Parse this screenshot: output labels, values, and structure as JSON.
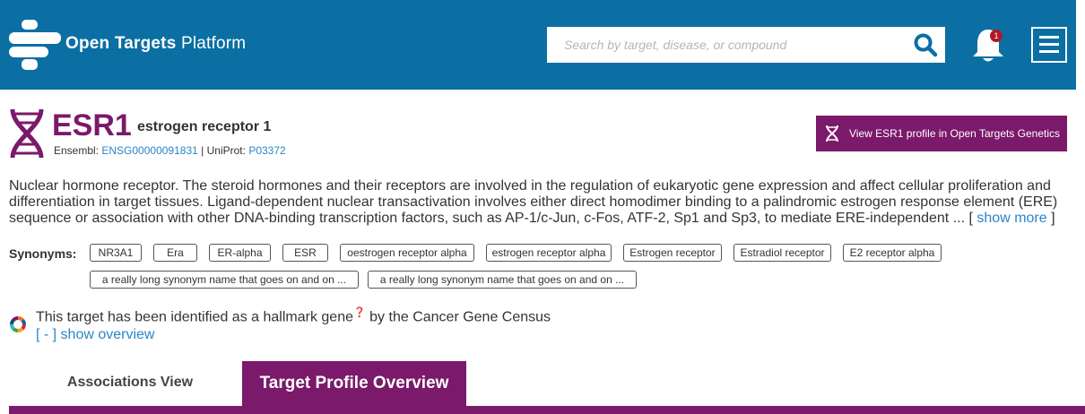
{
  "header": {
    "brand_bold": "Open Targets",
    "brand_light": "Platform",
    "search_placeholder": "Search by target, disease, or compound",
    "notification_count": "1"
  },
  "target": {
    "symbol": "ESR1",
    "full_name": "estrogen receptor 1",
    "ensembl_label": "Ensembl:",
    "ensembl_id": "ENSG00000091831",
    "separator": "|",
    "uniprot_label": "UniProt:",
    "uniprot_id": "P03372",
    "genetics_button": "View ESR1 profile in Open Targets Genetics"
  },
  "description": {
    "text": "Nuclear hormone receptor. The steroid hormones and their receptors are involved in the regulation of eukaryotic gene expression and affect cellular proliferation and differentiation in target tissues. Ligand-dependent nuclear transactivation involves either direct homodimer binding to a palindromic estrogen response element (ERE) sequence or association with other DNA-binding transcription factors, such as AP-1/c-Jun, c-Fos, ATF-2, Sp1 and Sp3, to mediate ERE-independent ...",
    "open_bracket": "[",
    "show_more": "show more",
    "close_bracket": "]"
  },
  "synonyms": {
    "label": "Synonyms:",
    "items": [
      "NR3A1",
      "Era",
      "ER-alpha",
      "ESR",
      "oestrogen receptor alpha",
      "estrogen receptor alpha",
      "Estrogen receptor",
      "Estradiol receptor",
      "E2 receptor alpha",
      "a really long synonym name that goes on and on ...",
      "a really long synonym name that goes on and on ..."
    ]
  },
  "hallmark": {
    "text_before": "This target has been identified as a hallmark gene",
    "help_mark": "❓",
    "text_after": "by the Cancer Gene Census",
    "overview_link": "[ - ] show overview"
  },
  "tabs": {
    "associations": "Associations View",
    "profile": "Target Profile Overview"
  },
  "colors": {
    "header_blue": "#0b6fa4",
    "brand_purple": "#7b196b",
    "link_blue": "#2a86c8",
    "badge_red": "#b0182a"
  }
}
